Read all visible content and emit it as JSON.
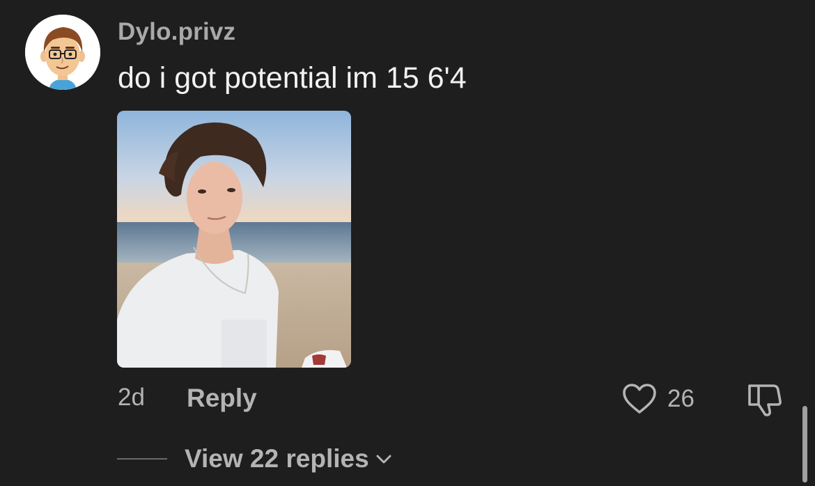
{
  "comment": {
    "username": "Dylo.privz",
    "text": "do i got potential im 15 6'4",
    "time": "2d",
    "reply_label": "Reply",
    "like_count": "26",
    "view_replies_label": "View 22 replies"
  },
  "icons": {
    "like": "heart-outline-icon",
    "dislike": "thumbs-down-outline-icon",
    "expand": "chevron-down-icon"
  },
  "colors": {
    "background": "#1e1e1e",
    "primary_text": "#f2f2f2",
    "secondary_text": "#b4b4b4"
  }
}
